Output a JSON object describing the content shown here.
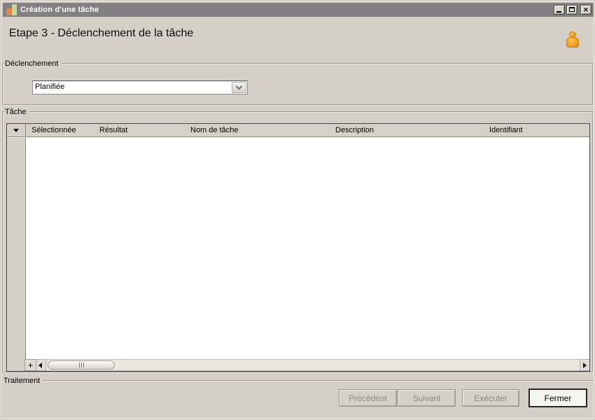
{
  "window": {
    "title": "Création d'une tâche"
  },
  "header": {
    "title": "Etape 3 - Déclenchement de la tâche",
    "icon": "person-icon"
  },
  "groups": {
    "declenchement": {
      "label": "Déclenchement",
      "trigger_select": {
        "value": "Planifiée"
      }
    },
    "tache": {
      "label": "Tâche",
      "grid": {
        "columns": [
          "Sélectionnée",
          "Résultat",
          "Nom de tâche",
          "Description",
          "Identifiant"
        ],
        "rows": []
      }
    },
    "traitement": {
      "label": "Traitement"
    }
  },
  "footer": {
    "buttons": [
      {
        "label": "Précédent",
        "enabled": false
      },
      {
        "label": "Suivant",
        "enabled": false
      },
      {
        "label": "Exécuter",
        "enabled": false
      },
      {
        "label": "Fermer",
        "enabled": true
      }
    ]
  },
  "colors": {
    "window_bg": "#d4d0c8",
    "titlebar_bg": "#828082",
    "grid_header_bg": "#d5d1c9",
    "grid_border": "#46464a",
    "accent_person": "#ef9415",
    "disabled_text": "#8d8981"
  }
}
